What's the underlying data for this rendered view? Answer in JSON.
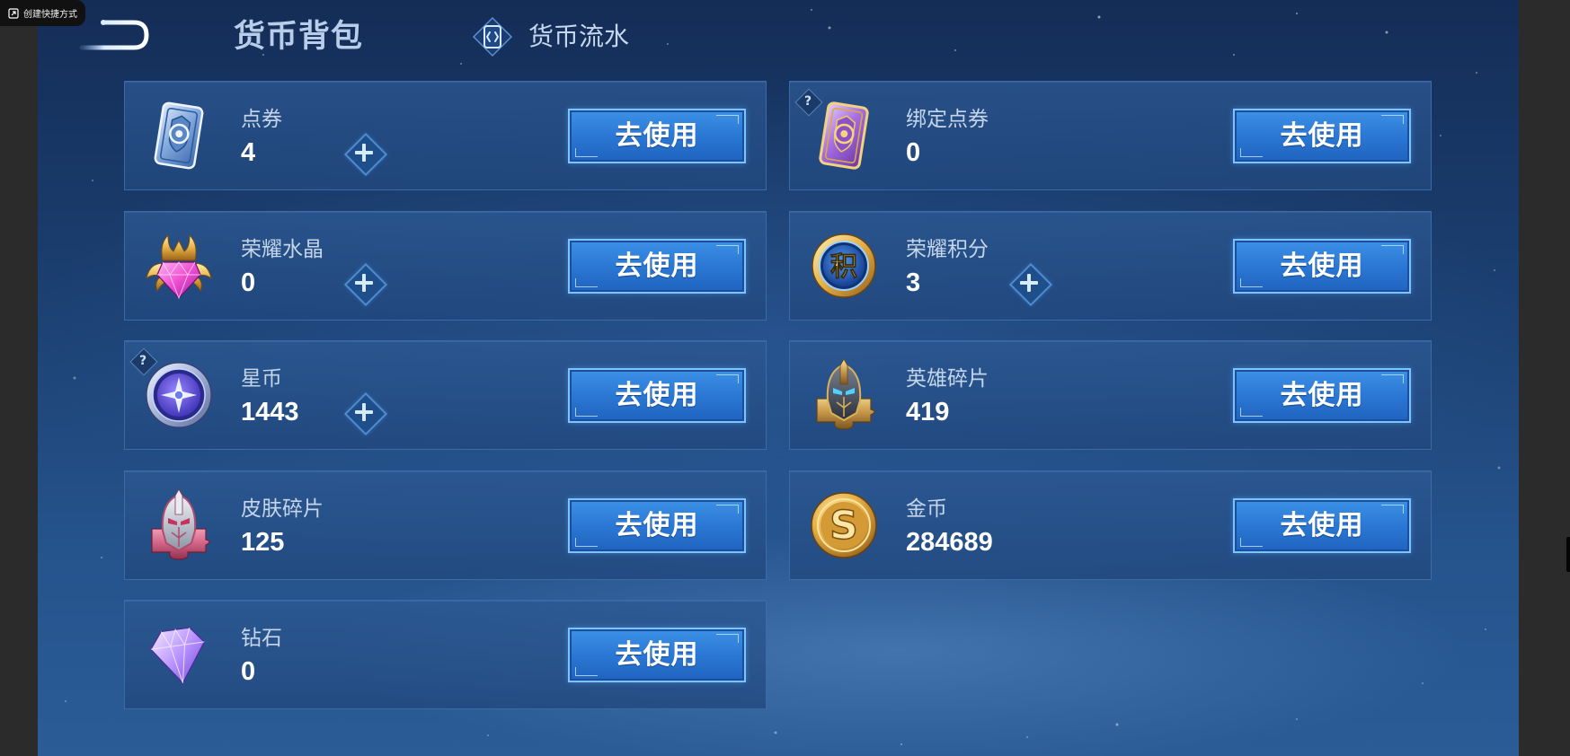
{
  "system_tooltip": {
    "label": "创建快捷方式",
    "icon": "shortcut-icon"
  },
  "header": {
    "back_icon": "back-arrow-icon",
    "title": "货币背包",
    "history_tab": {
      "label": "货币流水",
      "icon": "transaction-log-icon"
    }
  },
  "ui": {
    "help_glyph": "?"
  },
  "currencies": [
    {
      "name": "点券",
      "value": 4,
      "icon": "dianquan-icon",
      "button": "去使用",
      "can_add": true
    },
    {
      "name": "绑定点券",
      "value": 0,
      "icon": "bound-dianquan-icon",
      "button": "去使用",
      "has_help": true
    },
    {
      "name": "荣耀水晶",
      "value": 0,
      "icon": "glory-crystal-icon",
      "button": "去使用",
      "can_add": true
    },
    {
      "name": "荣耀积分",
      "value": 3,
      "icon": "glory-points-icon",
      "icon_text": "积",
      "button": "去使用",
      "can_add": true
    },
    {
      "name": "星币",
      "value": 1443,
      "icon": "star-coin-icon",
      "button": "去使用",
      "can_add": true,
      "has_help": true
    },
    {
      "name": "英雄碎片",
      "value": 419,
      "icon": "hero-shard-icon",
      "button": "去使用"
    },
    {
      "name": "皮肤碎片",
      "value": 125,
      "icon": "skin-shard-icon",
      "button": "去使用"
    },
    {
      "name": "金币",
      "value": 284689,
      "icon": "gold-coin-icon",
      "icon_text": "S",
      "button": "去使用"
    },
    {
      "name": "钻石",
      "value": 0,
      "icon": "diamond-icon",
      "button": "去使用"
    }
  ],
  "colors": {
    "background_top": "#142d57",
    "background_bottom": "#2b5c96",
    "card_border": "#3b6ba6",
    "button_fill": "#2b78d4",
    "button_border": "#7cc4ff",
    "label_text": "#c5d5ea",
    "value_text": "#ffffff"
  }
}
